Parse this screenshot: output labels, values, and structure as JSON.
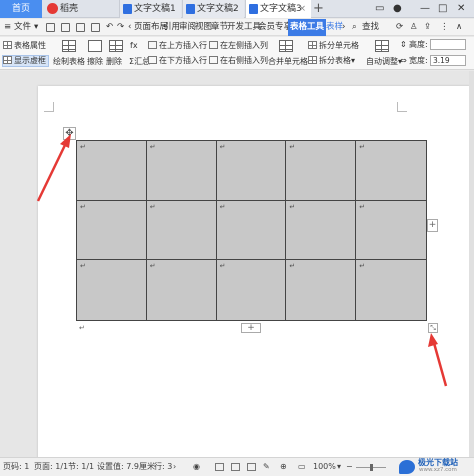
{
  "tabs": {
    "home": "首页",
    "daoke": "稻壳",
    "doc1": "文字文稿1",
    "doc2": "文字文稿2",
    "doc3": "文字文稿3"
  },
  "menu": {
    "file": "文件",
    "items": [
      "页面布局",
      "引用",
      "审阅",
      "视图",
      "章节",
      "开发工具",
      "会员专享"
    ],
    "table_tools": "表格工具",
    "table_style": "表样",
    "search": "查找"
  },
  "ribbon": {
    "table_props": "表格属性",
    "show_gridlines": "显示虚框",
    "draw_table": "绘制表格",
    "erase": "擦除",
    "delete": "删除",
    "summary": "汇总",
    "insert_above": "在上方插入行",
    "insert_below": "在下方插入行",
    "insert_left": "在左侧插入列",
    "insert_right": "在右侧插入列",
    "merge_cells": "合并单元格",
    "split_cells": "拆分单元格",
    "split_table": "拆分表格",
    "auto_adjust": "自动调整",
    "height_label": "高度:",
    "width_label": "宽度:",
    "width_value": "3.19"
  },
  "table": {
    "rows": 3,
    "cols": 5,
    "cell_mark": "↵"
  },
  "status": {
    "page_num": "页码: 1",
    "page": "页面: 1/1",
    "section": "节: 1/1",
    "setting": "设置值: 7.9厘米",
    "row": "行: 3",
    "zoom": "100%"
  },
  "watermark": {
    "title": "极光下载站",
    "sub": "www.xz7.com"
  },
  "colors": {
    "accent": "#3c7be6",
    "table_fill": "#c8c8c8",
    "arrow": "#e53935"
  }
}
